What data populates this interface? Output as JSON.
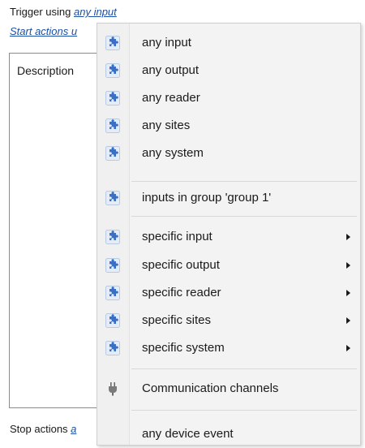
{
  "trigger": {
    "prefix": "Trigger using",
    "link": "any input"
  },
  "start_actions": {
    "text": "Start actions u"
  },
  "description": {
    "label": "Description"
  },
  "stop_actions": {
    "prefix": "Stop actions",
    "link": "a"
  },
  "menu": {
    "items": [
      {
        "label": "any input",
        "icon": "puzzle-icon"
      },
      {
        "label": "any output",
        "icon": "puzzle-icon"
      },
      {
        "label": "any reader",
        "icon": "puzzle-icon"
      },
      {
        "label": "any sites",
        "icon": "puzzle-icon"
      },
      {
        "label": "any system",
        "icon": "puzzle-icon"
      },
      {
        "label": "inputs in group 'group 1'",
        "icon": "puzzle-icon"
      },
      {
        "label": "specific input",
        "icon": "puzzle-icon",
        "submenu": true
      },
      {
        "label": "specific output",
        "icon": "puzzle-icon",
        "submenu": true
      },
      {
        "label": "specific reader",
        "icon": "puzzle-icon",
        "submenu": true
      },
      {
        "label": "specific sites",
        "icon": "puzzle-icon",
        "submenu": true
      },
      {
        "label": "specific system",
        "icon": "puzzle-icon",
        "submenu": true
      },
      {
        "label": "Communication channels",
        "icon": "plug-icon"
      },
      {
        "label": "any device event",
        "icon": ""
      }
    ]
  },
  "colors": {
    "link": "#1b4fa8",
    "icon_blue": "#3a6fc4",
    "menu_bg": "#f3f3f3"
  }
}
